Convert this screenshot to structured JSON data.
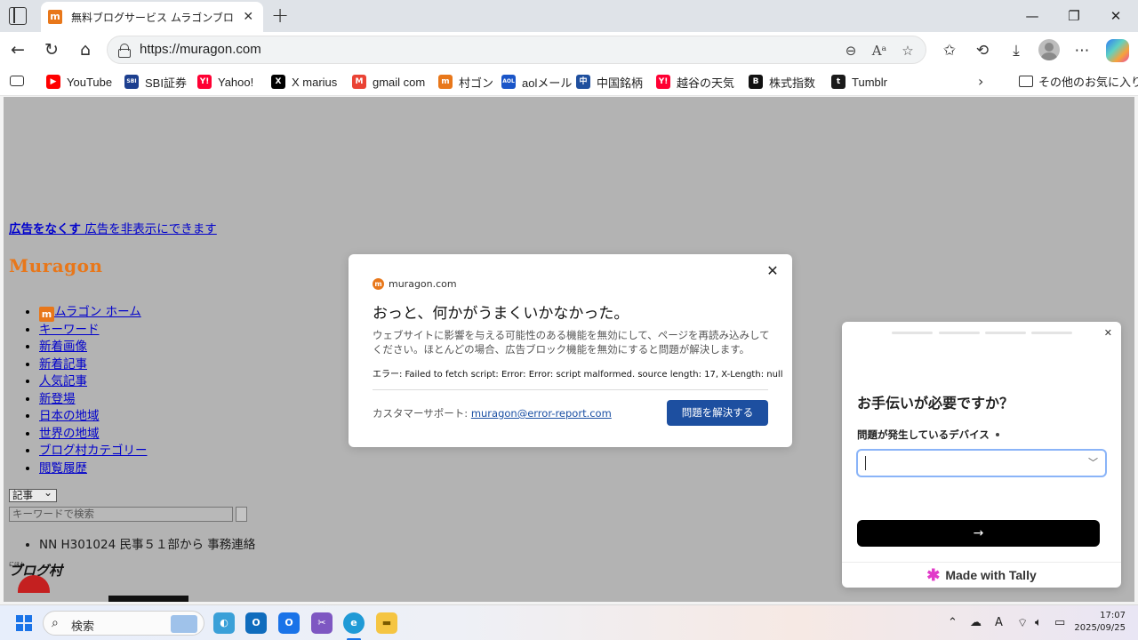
{
  "browser": {
    "tab_title": "無料ブログサービス ムラゴンブログ（mu",
    "url": "https://muragon.com",
    "bookmarks": [
      {
        "label": "YouTube",
        "icon": "youtube-icon",
        "color": "#ff0000",
        "glyph": "▶"
      },
      {
        "label": "SBI証券",
        "icon": "sbi-icon",
        "color": "#1d3f8f",
        "glyph": "SBI"
      },
      {
        "label": "Yahoo!",
        "icon": "yahoo-icon",
        "color": "#ff0033",
        "glyph": "Y!"
      },
      {
        "label": "X marius",
        "icon": "x-icon",
        "color": "#000000",
        "glyph": "X"
      },
      {
        "label": "gmail com",
        "icon": "gmail-icon",
        "color": "#ea4335",
        "glyph": "M"
      },
      {
        "label": "村ゴン",
        "icon": "muragon-icon",
        "color": "#e8771a",
        "glyph": "m"
      },
      {
        "label": "aolメール",
        "icon": "aol-icon",
        "color": "#1a55c8",
        "glyph": "AOL"
      },
      {
        "label": "中国銘柄",
        "icon": "china-stocks-icon",
        "color": "#1f4f9e",
        "glyph": "中"
      },
      {
        "label": "越谷の天気",
        "icon": "yahoo-weather-icon",
        "color": "#ff0033",
        "glyph": "Y!"
      },
      {
        "label": "株式指数",
        "icon": "b-icon",
        "color": "#111111",
        "glyph": "B"
      },
      {
        "label": "Tumblr",
        "icon": "tumblr-icon",
        "color": "#1a1a1a",
        "glyph": "t"
      }
    ],
    "other_favorites": "その他のお気に入り"
  },
  "page": {
    "ad_link_bold": "広告をなくす",
    "ad_link_rest": " 広告を非表示にできます",
    "logo": "Muragon",
    "nav": [
      "ムラゴン ホーム",
      "キーワード",
      "新着画像",
      "新着記事",
      "人気記事",
      "新登場",
      "日本の地域",
      "世界の地域",
      "ブログ村カテゴリー",
      "閲覧履歴"
    ],
    "select_value": "記事",
    "search_placeholder": "キーワードで検索",
    "news": [
      "NN H301024 民事５１部から 事務連絡"
    ],
    "village_logo": "ブログ村",
    "village_small": "にほん"
  },
  "dialog": {
    "site": "muragon.com",
    "title": "おっと、何かがうまくいかなかった。",
    "body": "ウェブサイトに影響を与える可能性のある機能を無効にして、ページを再読み込みしてください。ほとんどの場合、広告ブロック機能を無効にすると問題が解決します。",
    "error": "エラー: Failed to fetch script: Error: Error: script malformed. source length: 17, X-Length: null",
    "support_label": "カスタマーサポート: ",
    "support_email": "muragon@error-report.com",
    "resolve_button": "問題を解決する",
    "accent": "#1d4fa0"
  },
  "tally": {
    "question": "お手伝いが必要ですか？",
    "field_label": "問題が発生しているデバイス",
    "submit_arrow": "→",
    "footer": "Made with Tally",
    "steps_total": 4
  },
  "taskbar": {
    "search_label": "検索",
    "time": "17:07",
    "date": "2025/09/25",
    "ime": "A"
  }
}
